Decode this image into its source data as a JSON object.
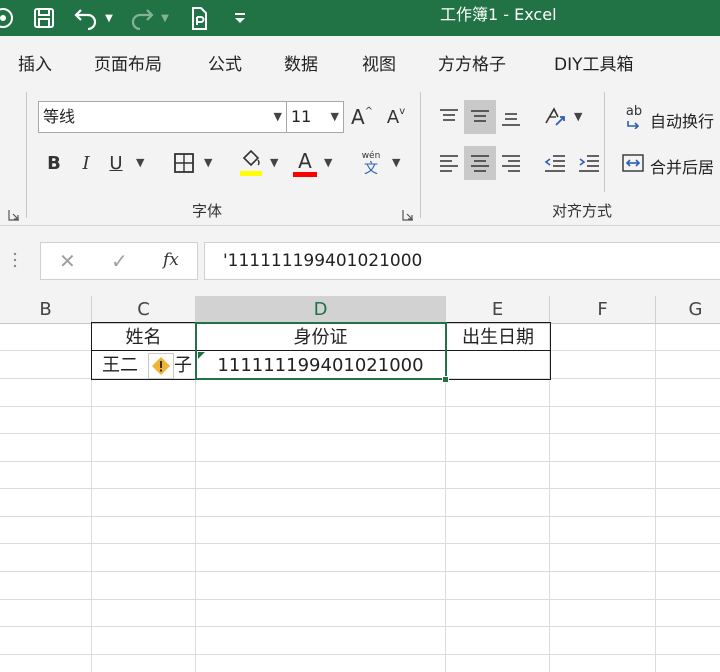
{
  "titlebar": {
    "title": "工作簿1  -  Excel",
    "icons": [
      "autosave-icon",
      "save-icon",
      "undo-icon",
      "redo-icon",
      "touch-mode-icon",
      "customize-toolbar-icon"
    ]
  },
  "tabs": [
    {
      "label": "插入"
    },
    {
      "label": "页面布局"
    },
    {
      "label": "公式"
    },
    {
      "label": "数据"
    },
    {
      "label": "视图"
    },
    {
      "label": "方方格子"
    },
    {
      "label": "DIY工具箱"
    }
  ],
  "ribbon": {
    "font_name": "等线",
    "font_size": "11",
    "bold": "B",
    "italic": "I",
    "underline": "U",
    "font_color_letter": "A",
    "grow_font": "A",
    "shrink_font": "A",
    "phonetic_top": "wén",
    "phonetic_bottom": "文",
    "font_group_label": "字体",
    "wrap_text": "自动换行",
    "wrap_icon_text": "ab",
    "merge_center": "合并后居",
    "align_group_label": "对齐方式",
    "fill_color": "#FFFF00",
    "font_color": "#FF0000"
  },
  "formula_bar": {
    "cancel": "✕",
    "enter": "✓",
    "fx": "fx",
    "value": "'111111199401021000"
  },
  "grid": {
    "columns": [
      "B",
      "C",
      "D",
      "E",
      "F",
      "G"
    ],
    "active_column": "D",
    "header_row": [
      "姓名",
      "身份证",
      "出生日期"
    ],
    "data_row": {
      "name_left": "王二",
      "name_right": "子",
      "id": "111111199401021000",
      "birth": ""
    }
  },
  "colors": {
    "accent": "#217346",
    "warning": "#F2B233"
  }
}
